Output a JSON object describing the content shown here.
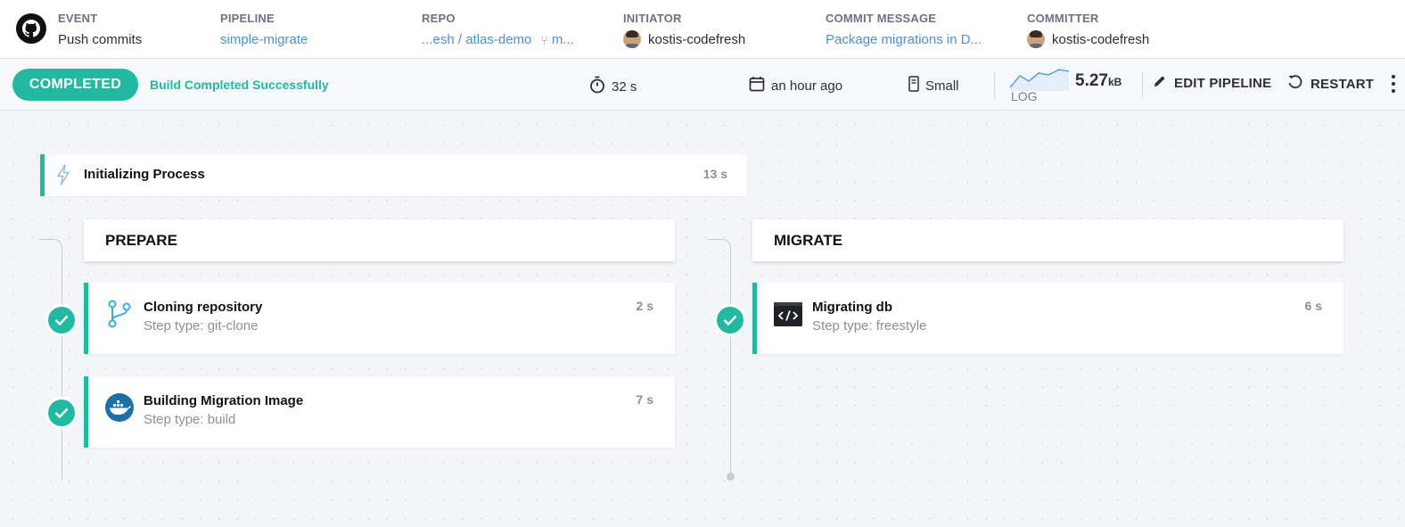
{
  "header": {
    "event": {
      "label": "EVENT",
      "value": "Push commits"
    },
    "pipeline": {
      "label": "PIPELINE",
      "value": "simple-migrate"
    },
    "repo": {
      "label": "REPO",
      "value": "...esh / atlas-demo",
      "branch": "m..."
    },
    "initiator": {
      "label": "INITIATOR",
      "value": "kostis-codefresh"
    },
    "commit_message": {
      "label": "COMMIT MESSAGE",
      "value": "Package migrations in D..."
    },
    "committer": {
      "label": "COMMITTER",
      "value": "kostis-codefresh"
    }
  },
  "status_bar": {
    "status_pill": "COMPLETED",
    "status_text": "Build Completed Successfully",
    "duration": "32 s",
    "started": "an hour ago",
    "size": "Small",
    "log_label": "LOG",
    "log_size_value": "5.27",
    "log_size_unit": "kB",
    "edit_pipeline": "EDIT PIPELINE",
    "restart": "RESTART"
  },
  "colors": {
    "accent": "#21b9a2",
    "link": "#4a90e2"
  },
  "pipeline": {
    "init": {
      "title": "Initializing Process",
      "duration": "13 s",
      "icon": "lightning-icon"
    },
    "stages": [
      {
        "name": "PREPARE",
        "steps": [
          {
            "name": "Cloning repository",
            "type": "Step type: git-clone",
            "duration": "2 s",
            "icon": "git-branch-icon",
            "status": "success"
          },
          {
            "name": "Building Migration Image",
            "type": "Step type: build",
            "duration": "7 s",
            "icon": "docker-icon",
            "status": "success"
          }
        ]
      },
      {
        "name": "MIGRATE",
        "steps": [
          {
            "name": "Migrating db",
            "type": "Step type: freestyle",
            "duration": "6 s",
            "icon": "code-terminal-icon",
            "status": "success"
          }
        ]
      }
    ]
  }
}
